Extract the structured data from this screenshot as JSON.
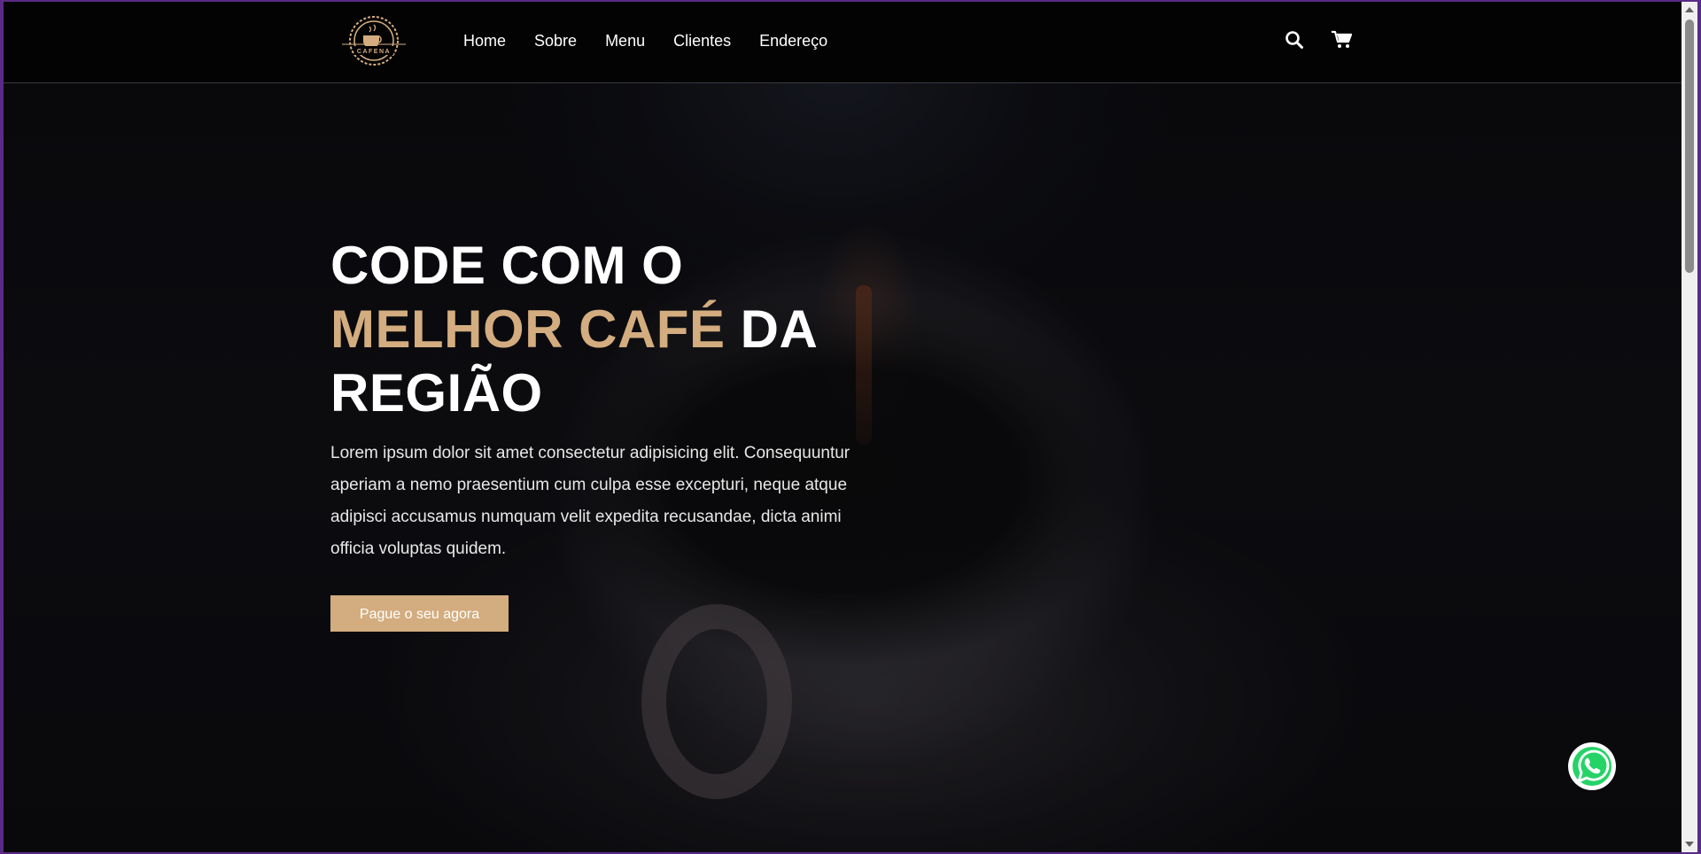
{
  "brand": {
    "logo_text": "CAFENA",
    "accent_color": "#d3ad7f"
  },
  "nav": {
    "items": [
      {
        "label": "Home"
      },
      {
        "label": "Sobre"
      },
      {
        "label": "Menu"
      },
      {
        "label": "Clientes"
      },
      {
        "label": "Endereço"
      }
    ]
  },
  "header_icons": {
    "search": "search-icon",
    "cart": "cart-icon"
  },
  "hero": {
    "title_line1": "CODE COM O",
    "title_accent": "MELHOR CAFÉ",
    "title_after_accent": " DA",
    "title_line3": "REGIÃO",
    "text": "Lorem ipsum dolor sit amet consectetur adipisicing elit. Consequuntur aperiam a nemo praesentium cum culpa esse excepturi, neque atque adipisci accusamus numquam velit expedita recusandae, dicta animi officia voluptas quidem.",
    "cta_label": "Pague o seu agora"
  },
  "floating": {
    "whatsapp": "whatsapp-icon",
    "whatsapp_color": "#25d366"
  }
}
